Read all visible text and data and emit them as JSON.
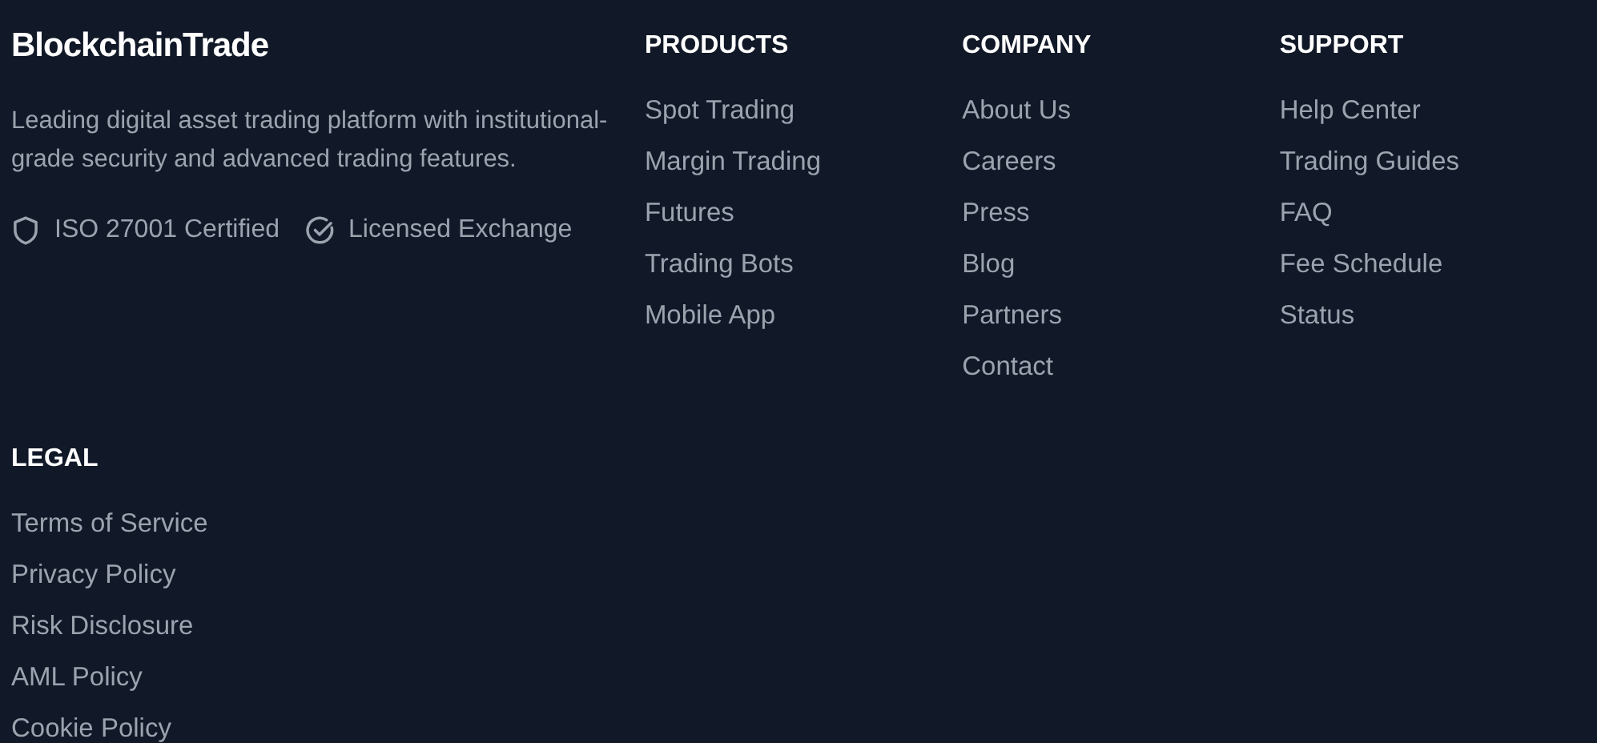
{
  "brand": {
    "name": "BlockchainTrade",
    "description": "Leading digital asset trading platform with institutional-grade security and advanced trading features.",
    "badges": [
      {
        "kind": "shield",
        "label": "ISO 27001 Certified"
      },
      {
        "kind": "check",
        "label": "Licensed Exchange"
      }
    ]
  },
  "columns": [
    {
      "heading": "PRODUCTS",
      "links": [
        "Spot Trading",
        "Margin Trading",
        "Futures",
        "Trading Bots",
        "Mobile App"
      ]
    },
    {
      "heading": "COMPANY",
      "links": [
        "About Us",
        "Careers",
        "Press",
        "Blog",
        "Partners",
        "Contact"
      ]
    },
    {
      "heading": "SUPPORT",
      "links": [
        "Help Center",
        "Trading Guides",
        "FAQ",
        "Fee Schedule",
        "Status"
      ]
    }
  ],
  "legal": {
    "heading": "LEGAL",
    "links": [
      "Terms of Service",
      "Privacy Policy",
      "Risk Disclosure",
      "AML Policy",
      "Cookie Policy"
    ]
  }
}
